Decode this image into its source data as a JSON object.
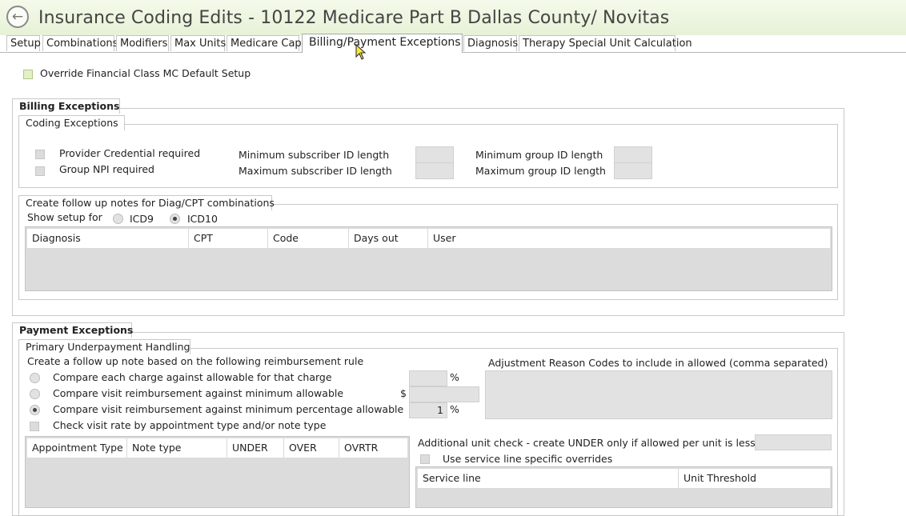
{
  "window": {
    "title": "Insurance Coding Edits - 10122 Medicare Part B Dallas County/ Novitas"
  },
  "tabs": [
    {
      "label": "Setup"
    },
    {
      "label": "Combinations"
    },
    {
      "label": "Modifiers"
    },
    {
      "label": "Max Units"
    },
    {
      "label": "Medicare Cap"
    },
    {
      "label": "Billing/Payment Exceptions",
      "active": true
    },
    {
      "label": "Diagnosis"
    },
    {
      "label": "Therapy Special Unit Calculation"
    }
  ],
  "override": {
    "label": "Override Financial Class MC Default Setup",
    "checked": false
  },
  "billing": {
    "title": "Billing Exceptions",
    "coding": {
      "title": "Coding Exceptions",
      "provider_credential": "Provider Credential required",
      "group_npi": "Group NPI required",
      "min_sub_id": "Minimum subscriber ID length",
      "max_sub_id": "Maximum subscriber ID length",
      "min_group_id": "Minimum group ID length",
      "max_group_id": "Maximum group ID length",
      "min_sub_id_value": "",
      "max_sub_id_value": "",
      "min_group_id_value": "",
      "max_group_id_value": ""
    },
    "followup": {
      "title": "Create follow up notes for Diag/CPT combinations",
      "show_setup_for": "Show setup for",
      "icd9": "ICD9",
      "icd10": "ICD10",
      "selected": "ICD10",
      "columns": [
        "Diagnosis",
        "CPT",
        "Code",
        "Days out",
        "User"
      ]
    }
  },
  "payment": {
    "title": "Payment Exceptions",
    "primary": {
      "title": "Primary Underpayment Handling",
      "rule_heading": "Create a follow up note based on the following reimbursement rule",
      "options": [
        "Compare each charge against allowable for that charge",
        "Compare visit reimbursement against minimum allowable",
        "Compare visit reimbursement against minimum percentage allowable"
      ],
      "selected_option": 2,
      "percent_symbol": "%",
      "dollar_symbol": "$",
      "percent1_value": "",
      "dollar_value": "",
      "percent2_value": "1",
      "check_visit_rate": "Check visit rate by appointment type and/or note type",
      "adjustment_label": "Adjustment Reason Codes to include in allowed (comma separated)",
      "adjustment_value": "",
      "appt_columns": [
        "Appointment Type",
        "Note type",
        "UNDER",
        "OVER",
        "OVRTR"
      ],
      "additional_unit_check": "Additional unit check - create UNDER only if allowed per unit is less than",
      "additional_unit_value": "",
      "use_service_line": "Use service line specific overrides",
      "service_columns": [
        "Service line",
        "Unit Threshold"
      ]
    }
  }
}
